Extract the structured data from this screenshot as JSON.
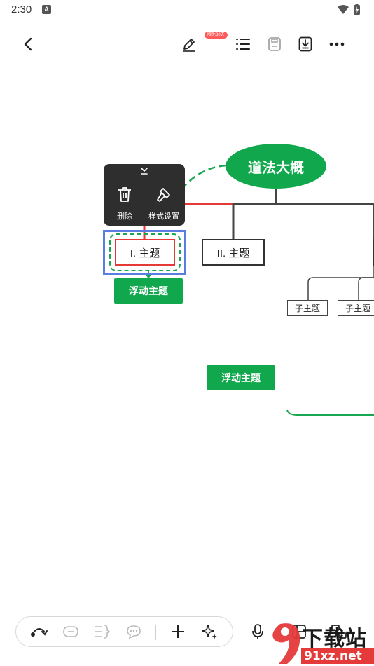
{
  "status_bar": {
    "time": "2:30",
    "notification_icon": "a-letter-icon",
    "icons": [
      "wifi-icon",
      "battery-icon"
    ]
  },
  "toolbar": {
    "back_icon": "chevron-left-icon",
    "actions": [
      "pen-icon",
      "outline-list-icon",
      "save-icon",
      "download-icon",
      "more-icon"
    ],
    "badge": "限免30天"
  },
  "mindmap": {
    "root": "道法大概",
    "topics": [
      "I. 主题",
      "II. 主题"
    ],
    "subtopics": [
      "子主题",
      "子主题"
    ],
    "floating": [
      "浮动主题",
      "浮动主题"
    ],
    "colors": {
      "node_green": "#11a84d",
      "selection_blue": "#5a7de0",
      "highlight_red": "#e53935",
      "dashed_green": "#18a650"
    }
  },
  "context_menu": {
    "collapse_icon": "chevron-double-down-icon",
    "items": [
      {
        "label": "删除",
        "icon": "trash-icon"
      },
      {
        "label": "样式设置",
        "icon": "hammer-icon"
      }
    ]
  },
  "bottom_toolbar": {
    "buttons": [
      "connect-curve-icon",
      "label-icon",
      "summary-brace-icon",
      "comment-icon",
      "add-icon",
      "ai-sparkle-icon"
    ],
    "side_buttons": [
      "microphone-icon",
      "layout-icon",
      "structure-icon"
    ]
  },
  "watermark": {
    "site": "下载站",
    "url": "91xz.net"
  }
}
